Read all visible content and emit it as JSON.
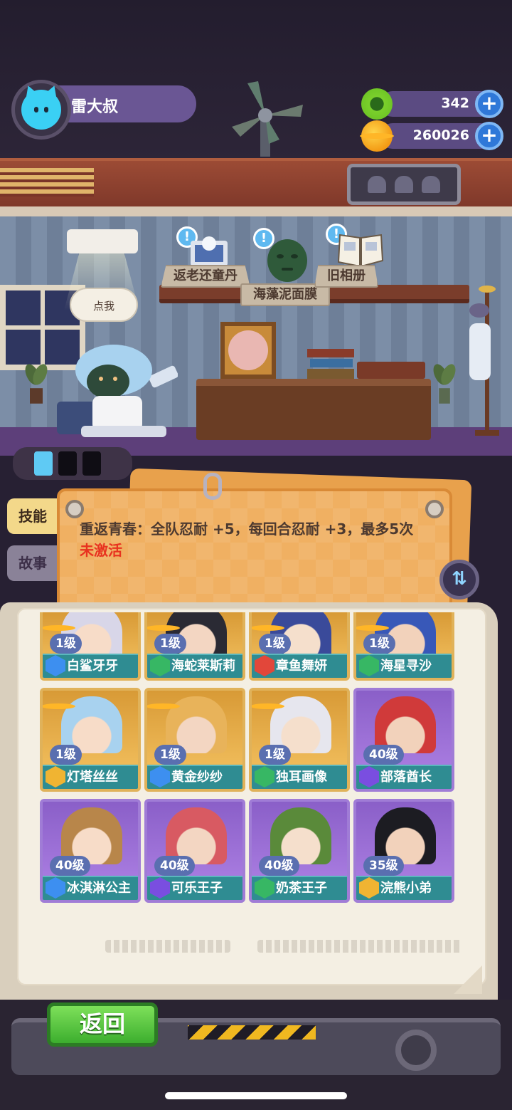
{
  "player": {
    "name": "雷大叔"
  },
  "currencies": [
    {
      "name": "gem",
      "value": "342",
      "icon": "green-gem-coin-icon"
    },
    {
      "name": "gold",
      "value": "260026",
      "icon": "gold-planet-coin-icon"
    }
  ],
  "room_items": [
    {
      "label": "返老还童丹"
    },
    {
      "label": "海藻泥面膜"
    },
    {
      "label": "旧相册"
    }
  ],
  "speech_bubble": "点我",
  "tabs": {
    "skill": "技能",
    "story": "故事"
  },
  "skill": {
    "text": "重返青春：全队忍耐 +5，每回合忍耐 +3，最多5次",
    "status": "未激活"
  },
  "characters": [
    {
      "level": "1级",
      "name": "白鲨牙牙",
      "class_color": "blue",
      "card": "gold"
    },
    {
      "level": "1级",
      "name": "海蛇莱斯莉",
      "class_color": "green",
      "card": "gold"
    },
    {
      "level": "1级",
      "name": "章鱼舞妍",
      "class_color": "red",
      "card": "gold"
    },
    {
      "level": "1级",
      "name": "海星寻沙",
      "class_color": "green",
      "card": "gold"
    },
    {
      "level": "1级",
      "name": "灯塔丝丝",
      "class_color": "yellow",
      "card": "gold",
      "selected": true
    },
    {
      "level": "1级",
      "name": "黄金纱纱",
      "class_color": "blue",
      "card": "gold"
    },
    {
      "level": "1级",
      "name": "独耳画像",
      "class_color": "green",
      "card": "gold"
    },
    {
      "level": "40级",
      "name": "部落酋长",
      "class_color": "violet",
      "card": "purple"
    },
    {
      "level": "40级",
      "name": "冰淇淋公主",
      "class_color": "blue",
      "card": "purple"
    },
    {
      "level": "40级",
      "name": "可乐王子",
      "class_color": "violet",
      "card": "purple"
    },
    {
      "level": "40级",
      "name": "奶茶王子",
      "class_color": "green",
      "card": "purple"
    },
    {
      "level": "35级",
      "name": "浣熊小弟",
      "class_color": "yellow",
      "card": "purple"
    }
  ],
  "buttons": {
    "back": "返回",
    "plus": "+",
    "swap": "⇅"
  },
  "colors": {
    "skill_inactive": "#e8321f",
    "back_button": "#3cae2e",
    "accent_blue": "#2f78d8"
  }
}
